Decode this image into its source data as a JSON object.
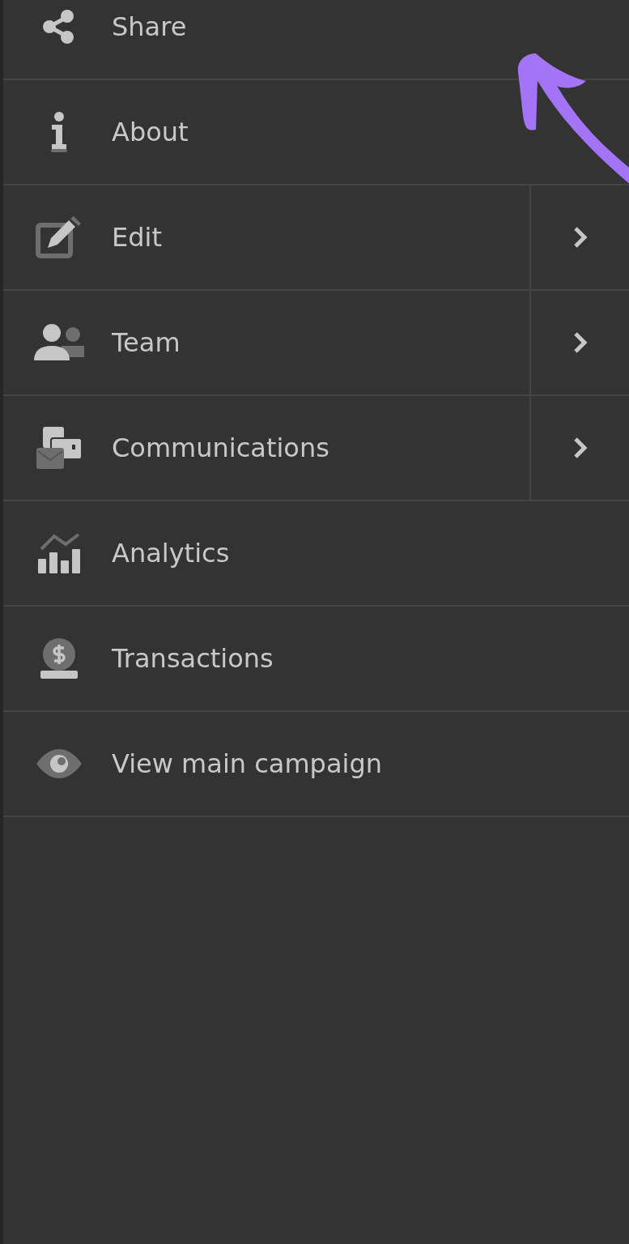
{
  "menu": {
    "items": [
      {
        "label": "Share",
        "has_submenu": false
      },
      {
        "label": "About",
        "has_submenu": false
      },
      {
        "label": "Edit",
        "has_submenu": true
      },
      {
        "label": "Team",
        "has_submenu": true
      },
      {
        "label": "Communications",
        "has_submenu": true
      },
      {
        "label": "Analytics",
        "has_submenu": false
      },
      {
        "label": "Transactions",
        "has_submenu": false
      },
      {
        "label": "View main campaign",
        "has_submenu": false
      }
    ]
  }
}
